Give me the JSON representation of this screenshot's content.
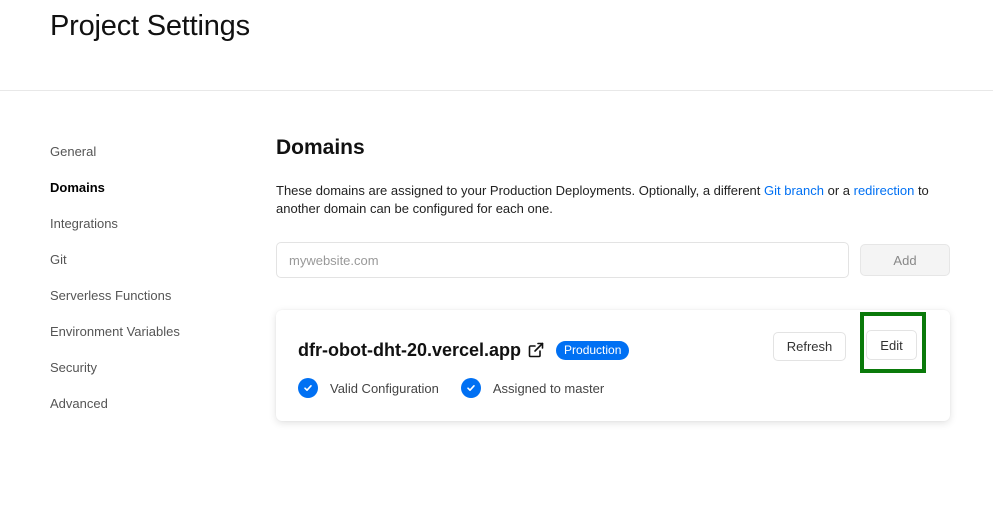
{
  "page": {
    "title": "Project Settings"
  },
  "sidebar": {
    "items": [
      {
        "label": "General",
        "active": false
      },
      {
        "label": "Domains",
        "active": true
      },
      {
        "label": "Integrations",
        "active": false
      },
      {
        "label": "Git",
        "active": false
      },
      {
        "label": "Serverless Functions",
        "active": false
      },
      {
        "label": "Environment Variables",
        "active": false
      },
      {
        "label": "Security",
        "active": false
      },
      {
        "label": "Advanced",
        "active": false
      }
    ]
  },
  "domains": {
    "title": "Domains",
    "description": {
      "part1": "These domains are assigned to your Production Deployments. Optionally, a different ",
      "link1": "Git branch",
      "part2": " or a ",
      "link2": "redirection",
      "part3": " to another domain can be configured for each one."
    },
    "input": {
      "value": "",
      "placeholder": "mywebsite.com"
    },
    "add_label": "Add",
    "card": {
      "domain": "dfr-obot-dht-20.vercel.app",
      "external_link_icon": "external-link-icon",
      "badge": "Production",
      "refresh_label": "Refresh",
      "edit_label": "Edit",
      "statuses": [
        {
          "label": "Valid Configuration",
          "icon": "check-circle-icon"
        },
        {
          "label": "Assigned to master",
          "icon": "check-circle-icon"
        }
      ]
    }
  },
  "colors": {
    "accent": "#0070f3",
    "highlight": "#0a7a0a"
  }
}
